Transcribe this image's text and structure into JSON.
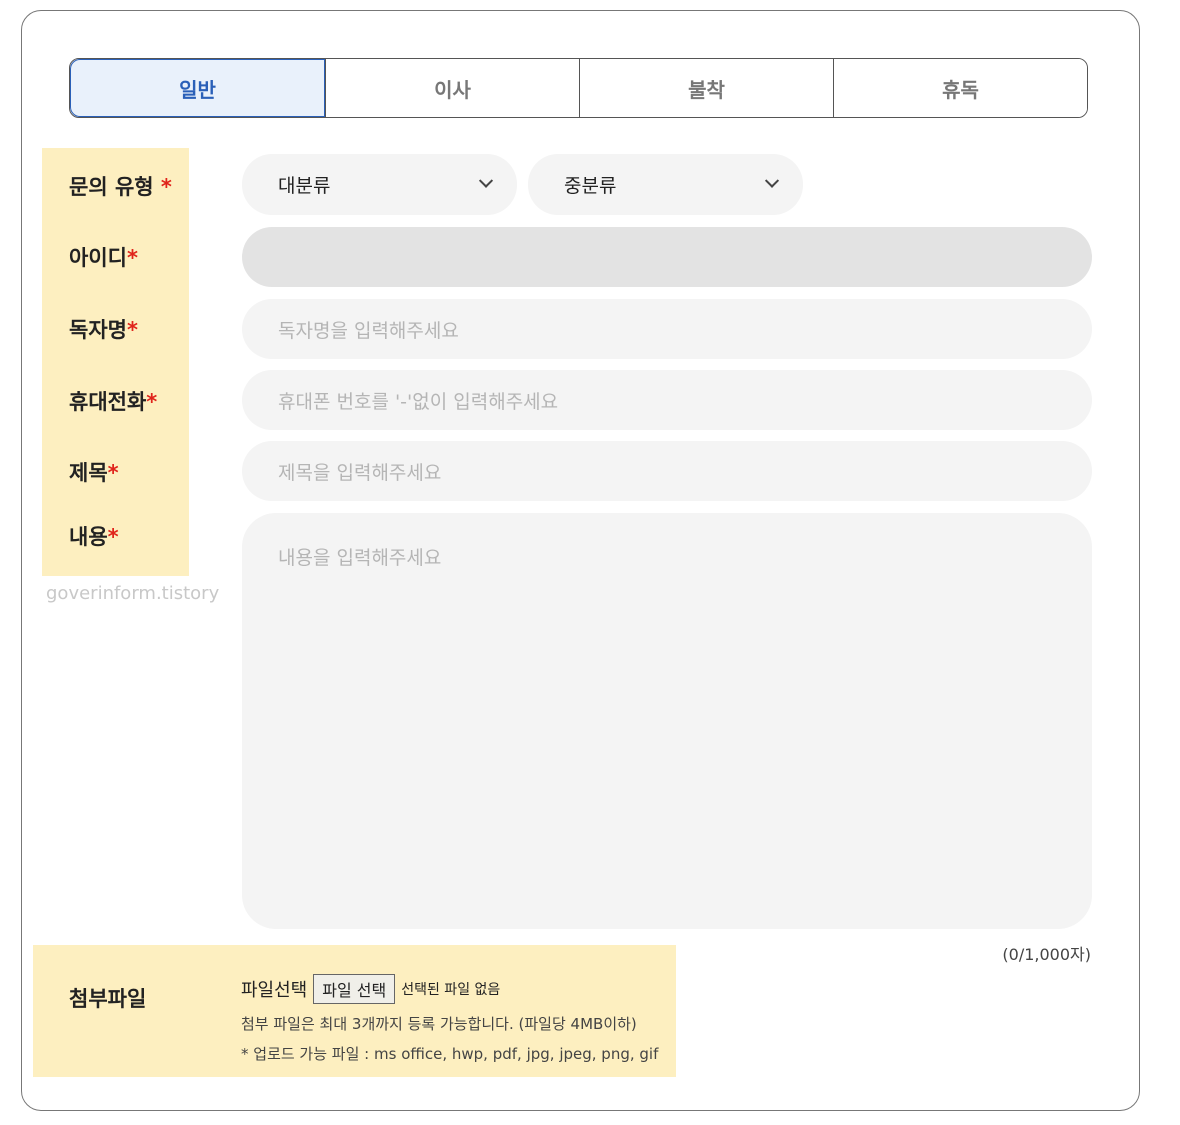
{
  "tabs": [
    {
      "label": "일반",
      "active": true
    },
    {
      "label": "이사",
      "active": false
    },
    {
      "label": "불착",
      "active": false
    },
    {
      "label": "휴독",
      "active": false
    }
  ],
  "labels": {
    "inquiry_type": "문의 유형",
    "user_id": "아이디",
    "reader_name": "독자명",
    "phone": "휴대전화",
    "title": "제목",
    "content": "내용",
    "required_mark": "*"
  },
  "watermark": "goverinform.tistory",
  "selects": {
    "category_main": "대분류",
    "category_sub": "중분류"
  },
  "fields": {
    "user_id_value": "",
    "reader_name_placeholder": "독자명을 입력해주세요",
    "phone_placeholder": "휴대폰 번호를 '-'없이 입력해주세요",
    "title_placeholder": "제목을 입력해주세요",
    "content_placeholder": "내용을 입력해주세요"
  },
  "counter": "(0/1,000자)",
  "attachment": {
    "label": "첨부파일",
    "title": "파일선택",
    "button": "파일 선택",
    "status": "선택된 파일 없음",
    "note1": "첨부 파일은 최대 3개까지 등록 가능합니다. (파일당 4MB이하)",
    "note2": "* 업로드 가능 파일 : ms office, hwp, pdf, jpg, jpeg, png, gif"
  },
  "colors": {
    "highlight": "#fdefc0",
    "active_tab_text": "#2a60b8",
    "required": "#e0241b"
  }
}
